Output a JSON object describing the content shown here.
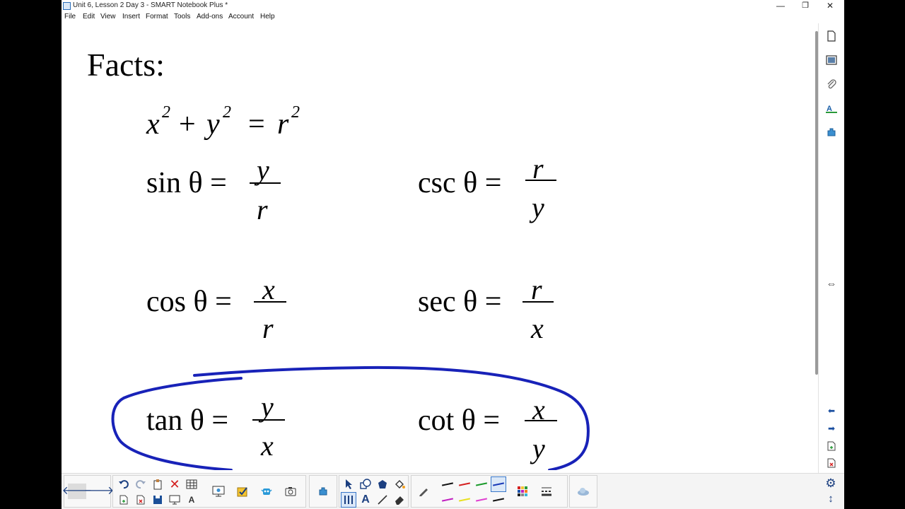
{
  "window": {
    "title": "Unit 6, Lesson 2 Day 3 - SMART Notebook Plus *",
    "minimize_glyph": "—",
    "maximize_glyph": "❐",
    "close_glyph": "✕"
  },
  "menu": [
    "File",
    "Edit",
    "View",
    "Insert",
    "Format",
    "Tools",
    "Add-ons",
    "Account",
    "Help"
  ],
  "page": {
    "heading": "Facts:",
    "identity": {
      "x": "x",
      "plus": "+",
      "y": "y",
      "equals": "=",
      "r": "r",
      "exp": "2"
    },
    "trig": {
      "sin": {
        "lhs": "sin θ =",
        "num": "y",
        "den": "r"
      },
      "csc": {
        "lhs": "csc θ =",
        "num": "r",
        "den": "y"
      },
      "cos": {
        "lhs": "cos θ =",
        "num": "x",
        "den": "r"
      },
      "sec": {
        "lhs": "sec θ =",
        "num": "r",
        "den": "x"
      },
      "tan": {
        "lhs": "tan θ =",
        "num": "y",
        "den": "x"
      },
      "cot": {
        "lhs": "cot θ =",
        "num": "x",
        "den": "y"
      }
    },
    "annotation_color": "#1822b8"
  },
  "sidebar": {
    "icons": [
      "page-sorter-icon",
      "gallery-icon",
      "attachments-icon",
      "properties-icon",
      "add-ons-icon"
    ],
    "resize_glyph": "⇔",
    "bottom_glyphs": [
      "⬅",
      "➡"
    ]
  },
  "toolbar": {
    "nav": {
      "back": "🡐",
      "forward": "🡒"
    },
    "settings_glyph": "⚙",
    "move_glyph": "↕",
    "pen_colors_top": [
      "#111111",
      "#d42020",
      "#1a9a2a",
      "#1a3ab8"
    ],
    "pen_colors_bottom": [
      "#c020c0",
      "#e8e020",
      "#e040d0",
      "#111111"
    ],
    "text_tool_glyph": "A"
  }
}
